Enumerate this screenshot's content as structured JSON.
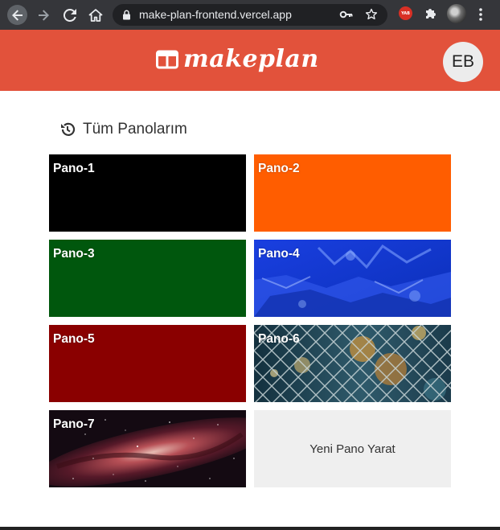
{
  "browser": {
    "url": "make-plan-frontend.vercel.app",
    "extension_badge": "YAB",
    "icons": [
      "back-icon",
      "forward-icon",
      "reload-icon",
      "home-icon",
      "lock-icon",
      "key-icon",
      "star-icon",
      "puzzle-icon",
      "kebab-menu-icon"
    ]
  },
  "header": {
    "brand": "makeplan",
    "avatar_initials": "EB",
    "color": "#e2523b"
  },
  "section": {
    "title": "Tüm Panolarım",
    "icon": "history-icon"
  },
  "boards": [
    {
      "title": "Pano-1",
      "background": "#000000"
    },
    {
      "title": "Pano-2",
      "background": "#ff5d00"
    },
    {
      "title": "Pano-3",
      "background": "#00570d"
    },
    {
      "title": "Pano-4",
      "background": "image:blue-water"
    },
    {
      "title": "Pano-5",
      "background": "#8a0000"
    },
    {
      "title": "Pano-6",
      "background": "image:chain-fence-bokeh"
    },
    {
      "title": "Pano-7",
      "background": "image:milky-way"
    }
  ],
  "new_board_label": "Yeni Pano Yarat"
}
